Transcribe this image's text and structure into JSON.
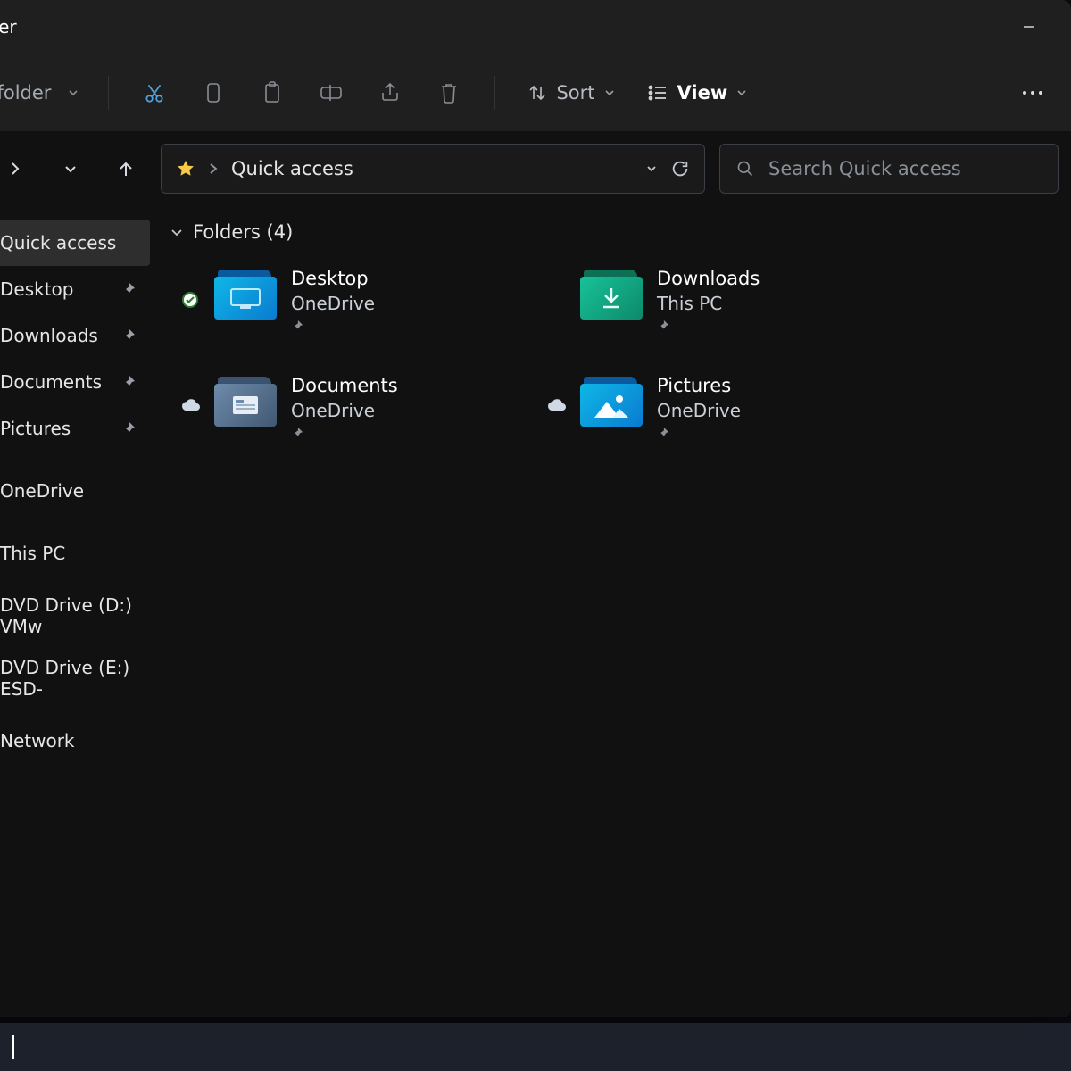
{
  "window": {
    "title": "xplorer"
  },
  "toolbar": {
    "new_folder": "New folder",
    "sort_label": "Sort",
    "view_label": "View"
  },
  "address": {
    "location": "Quick access"
  },
  "search": {
    "placeholder": "Search Quick access"
  },
  "sidebar": {
    "items": [
      {
        "label": "Quick access",
        "pinned": false,
        "selected": true
      },
      {
        "label": "Desktop",
        "pinned": true
      },
      {
        "label": "Downloads",
        "pinned": true
      },
      {
        "label": "Documents",
        "pinned": true
      },
      {
        "label": "Pictures",
        "pinned": true
      }
    ],
    "groups": [
      {
        "label": "OneDrive"
      },
      {
        "label": "This PC"
      },
      {
        "label": "DVD Drive (D:) VMw"
      },
      {
        "label": "DVD Drive (E:) ESD-"
      },
      {
        "label": "Network"
      }
    ]
  },
  "content": {
    "group_header": "Folders (4)",
    "items": [
      {
        "name": "Desktop",
        "location": "OneDrive",
        "sync": "ok",
        "color": "blue",
        "icon": "desktop"
      },
      {
        "name": "Downloads",
        "location": "This PC",
        "sync": "none",
        "color": "green",
        "icon": "downloads"
      },
      {
        "name": "Documents",
        "location": "OneDrive",
        "sync": "cloud",
        "color": "steel",
        "icon": "documents"
      },
      {
        "name": "Pictures",
        "location": "OneDrive",
        "sync": "cloud",
        "color": "blue",
        "icon": "pictures"
      }
    ]
  }
}
